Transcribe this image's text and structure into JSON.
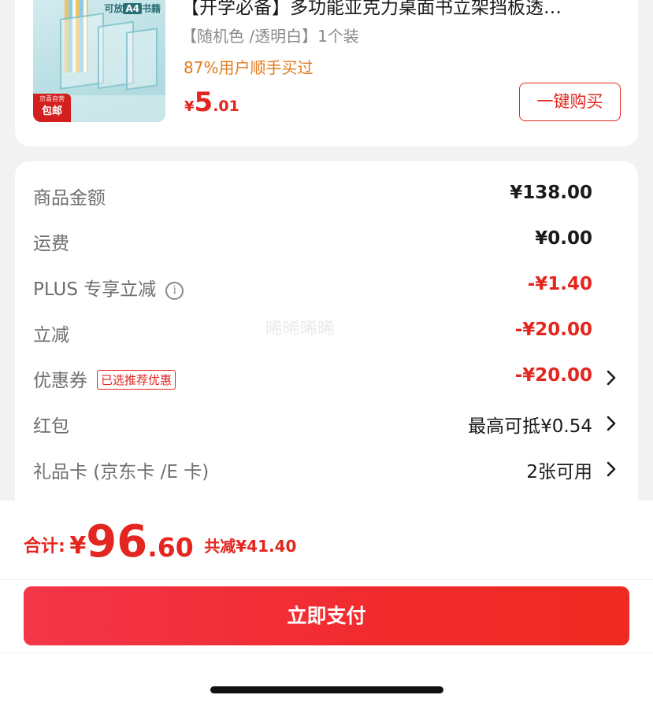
{
  "product": {
    "title": "【开学必备】多功能亚克力桌面书立架挡板透…",
    "spec": "【随机色 /透明白】1个装",
    "hint": "87%用户顺手买过",
    "price_symbol": "¥",
    "price_int": "5",
    "price_dec": ".01",
    "buy_button": "一键购买",
    "thumb_text_prefix": "可放",
    "thumb_text_a4": "A4",
    "thumb_text_suffix": "书籍",
    "thumb_badge_top": "京喜自营",
    "thumb_badge_main": "包邮"
  },
  "summary": {
    "rows": [
      {
        "label": "商品金额",
        "value": "¥138.00"
      },
      {
        "label": "运费",
        "value": "¥0.00"
      },
      {
        "label": "PLUS 专享立减",
        "value": "-¥1.40"
      },
      {
        "label": "立减",
        "value": "-¥20.00"
      },
      {
        "label": "优惠券",
        "value": "-¥20.00",
        "tag": "已选推荐优惠"
      },
      {
        "label": "红包",
        "value": "最高可抵¥0.54"
      },
      {
        "label": "礼品卡 (京东卡 /E 卡)",
        "value": "2张可用"
      }
    ],
    "watermark": "晞晞晞晞"
  },
  "footer": {
    "total_label": "合计:",
    "total_symbol": "¥",
    "total_int": "96",
    "total_dec": ".60",
    "total_saved": "共减¥41.40",
    "pay_button": "立即支付"
  },
  "colors": {
    "accent": "#e3261f",
    "hint": "#e07b1f",
    "label_gray": "#6e6e6e",
    "background": "#f2f2f2"
  },
  "icons": {
    "info": "info-circle-icon",
    "chevron": "chevron-right-icon"
  }
}
